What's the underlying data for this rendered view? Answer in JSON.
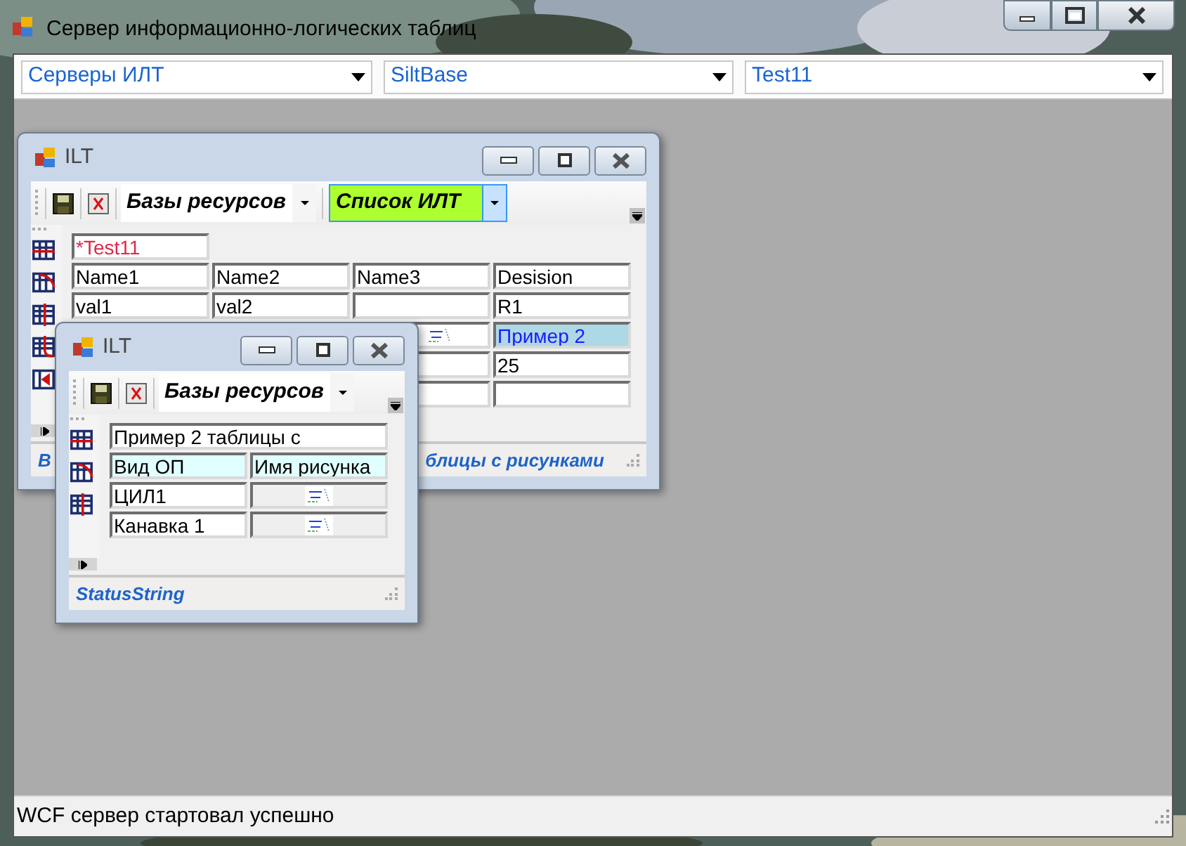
{
  "window": {
    "title": "Сервер информационно-логических таблиц"
  },
  "selectors": [
    {
      "value": "Серверы ИЛТ"
    },
    {
      "value": "SiltBase"
    },
    {
      "value": "Test11"
    }
  ],
  "child_windows": [
    {
      "title": "ILT",
      "toolbar": {
        "combos": [
          {
            "value": "Базы ресурсов",
            "highlighted": false
          },
          {
            "value": "Список ИЛТ",
            "highlighted": true
          }
        ]
      },
      "side_tools": [
        {
          "kind": "row-strike"
        },
        {
          "kind": "row-curve"
        },
        {
          "kind": "col-strike"
        },
        {
          "kind": "col-curve"
        },
        {
          "kind": "col-arrow"
        }
      ],
      "table": {
        "caption": "*Test11",
        "modified": true,
        "columns": [
          {
            "label": "Name1",
            "highlighted": false
          },
          {
            "label": "Name2",
            "highlighted": false
          },
          {
            "label": "Name3",
            "highlighted": false
          },
          {
            "label": "Desision",
            "highlighted": false
          }
        ],
        "rows": [
          {
            "cells": [
              {
                "kind": "text",
                "text": "val1"
              },
              {
                "kind": "text",
                "text": " val2"
              },
              {
                "kind": "empty"
              },
              {
                "kind": "text",
                "text": "R1"
              }
            ]
          },
          {
            "cells": [
              {
                "kind": "picture"
              },
              {
                "kind": "marked",
                "text": "Пример 2"
              }
            ]
          },
          {
            "cells": [
              {
                "kind": "empty"
              },
              {
                "kind": "text",
                "text": "25"
              }
            ]
          },
          {
            "cells": [
              {
                "kind": "empty"
              },
              {
                "kind": "empty"
              }
            ]
          }
        ]
      },
      "status": {
        "segments": [
          "В",
          "блицы с рисунками"
        ]
      }
    },
    {
      "title": "ILT",
      "toolbar": {
        "combos": [
          {
            "value": "Базы ресурсов",
            "highlighted": false
          }
        ]
      },
      "side_tools": [
        {
          "kind": "row-strike"
        },
        {
          "kind": "row-curve"
        },
        {
          "kind": "col-strike"
        }
      ],
      "table": {
        "caption": "Пример 2 таблицы с",
        "modified": false,
        "columns": [
          {
            "label": "Вид ОП",
            "highlighted": true
          },
          {
            "label": "Имя рисунка",
            "highlighted": true
          }
        ],
        "rows": [
          {
            "cells": [
              {
                "kind": "text",
                "text": "ЦИЛ1"
              },
              {
                "kind": "picture"
              }
            ]
          },
          {
            "cells": [
              {
                "kind": "text",
                "text": "Канавка 1"
              },
              {
                "kind": "picture"
              }
            ]
          }
        ]
      },
      "status": {
        "segments": [
          "StatusString"
        ]
      }
    }
  ],
  "status_bar": {
    "text": "WCF сервер стартовал успешно"
  }
}
